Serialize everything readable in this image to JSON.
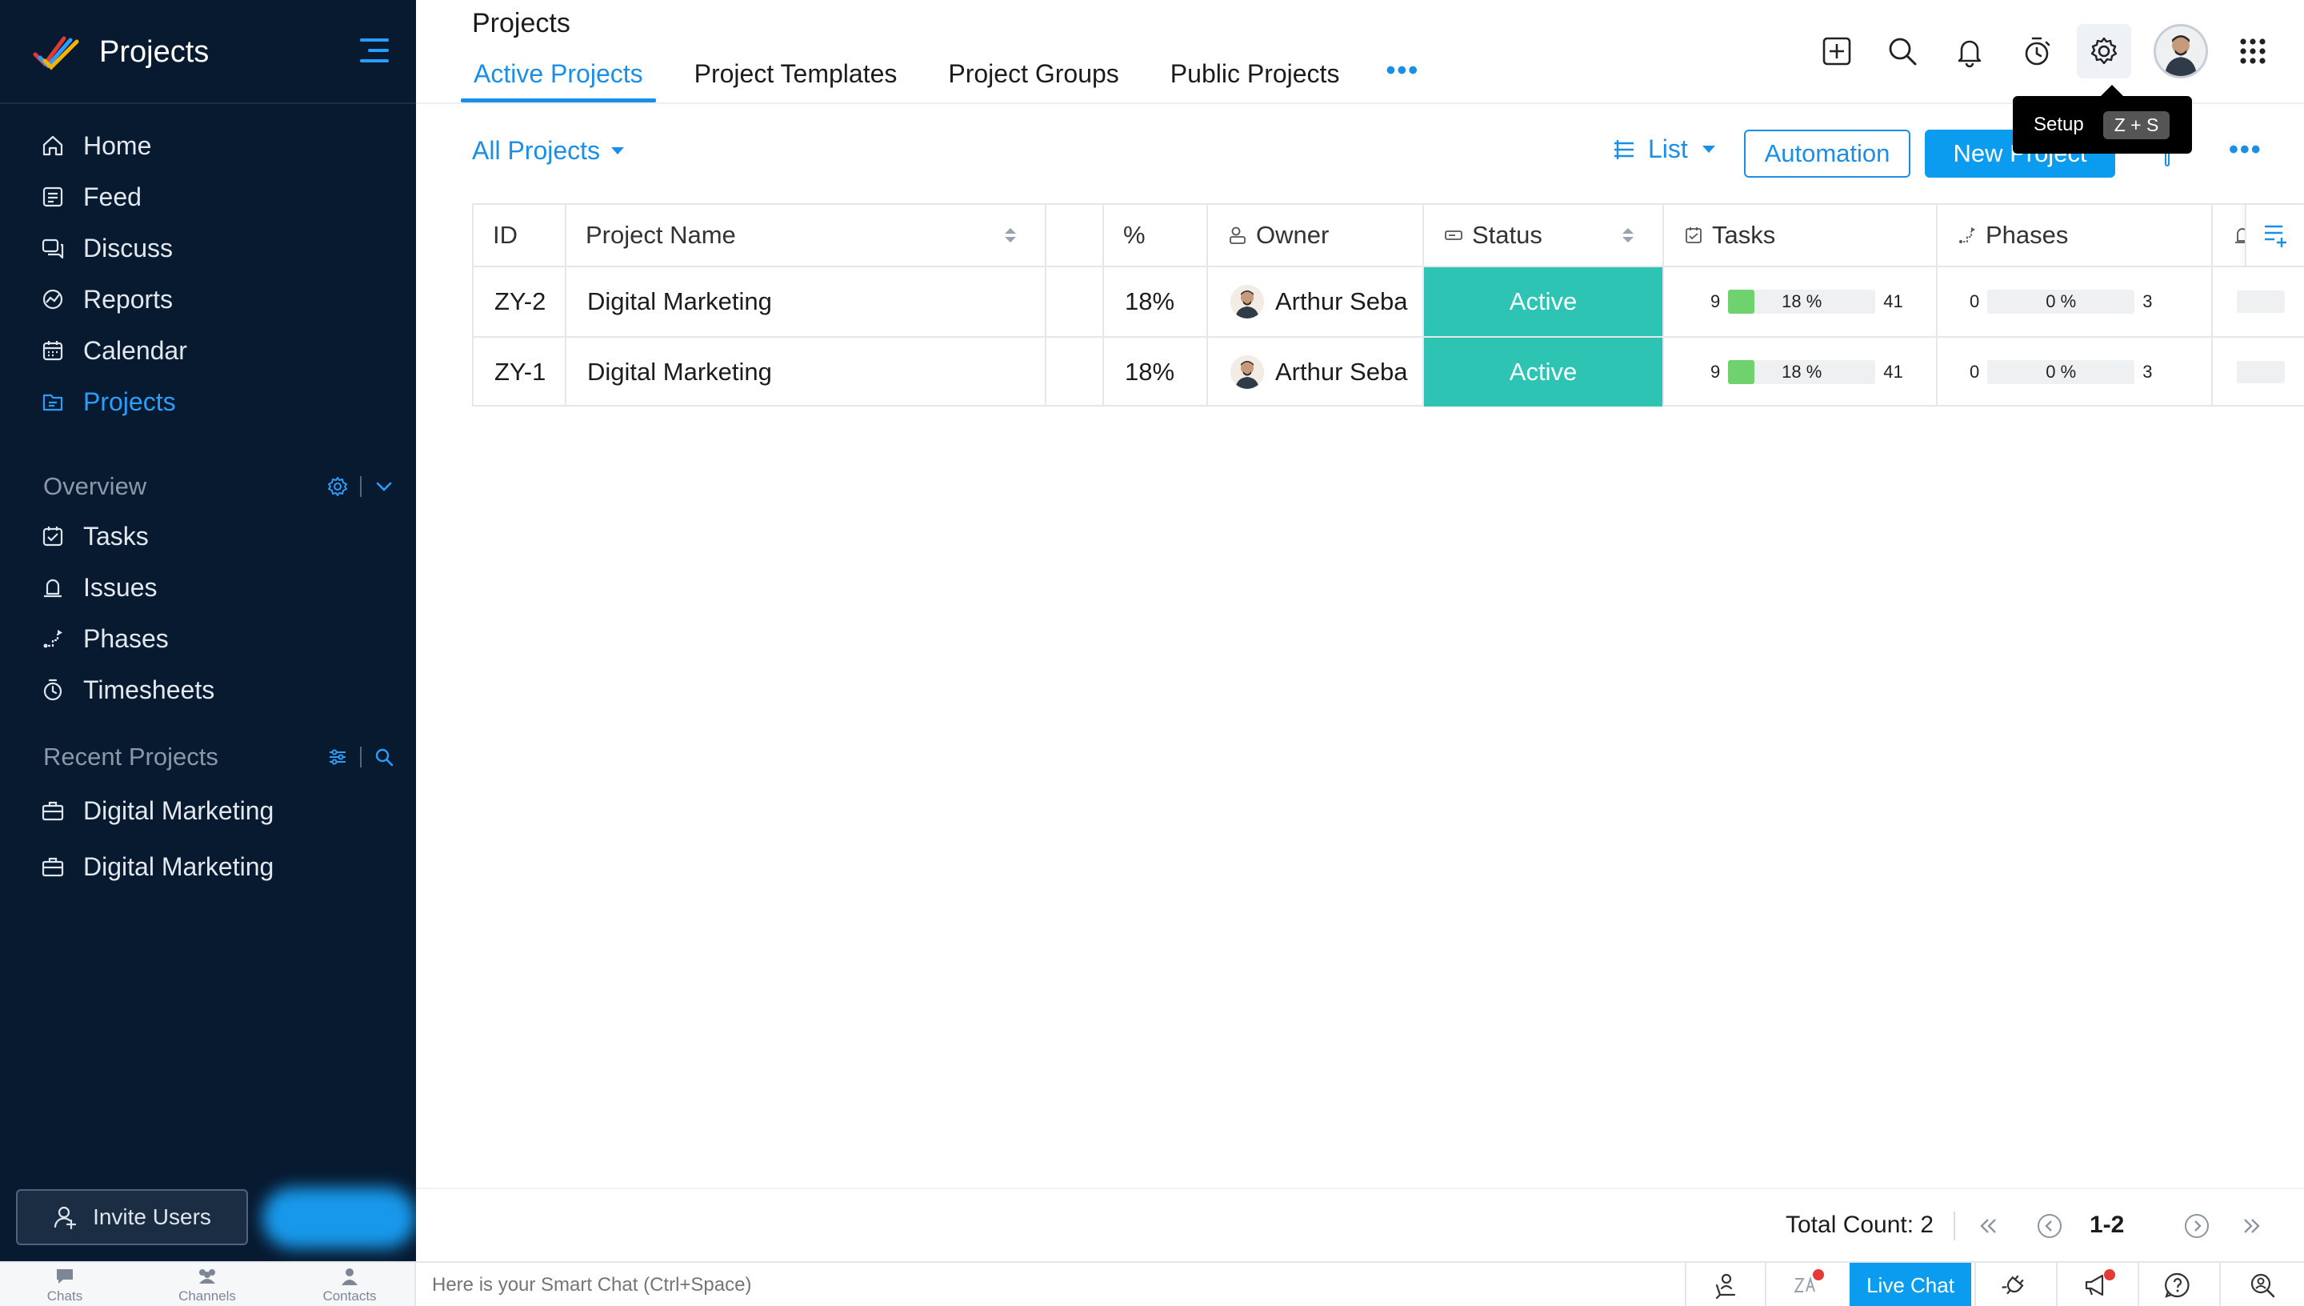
{
  "app": {
    "title": "Projects",
    "colors": {
      "accent": "#1a8fe8",
      "sidebar_bg": "#071a30",
      "status_active": "#2ec4b4",
      "progress_fill": "#6fd26f",
      "live_chat": "#0b9cf0"
    }
  },
  "sidebar": {
    "main_items": [
      {
        "label": "Home",
        "icon": "home-icon"
      },
      {
        "label": "Feed",
        "icon": "feed-icon"
      },
      {
        "label": "Discuss",
        "icon": "discuss-icon"
      },
      {
        "label": "Reports",
        "icon": "reports-icon"
      },
      {
        "label": "Calendar",
        "icon": "calendar-icon"
      },
      {
        "label": "Projects",
        "icon": "projects-icon",
        "active": true
      }
    ],
    "overview": {
      "title": "Overview",
      "items": [
        {
          "label": "Tasks",
          "icon": "tasks-icon"
        },
        {
          "label": "Issues",
          "icon": "issues-icon"
        },
        {
          "label": "Phases",
          "icon": "phases-icon"
        },
        {
          "label": "Timesheets",
          "icon": "timesheets-icon"
        }
      ]
    },
    "recent": {
      "title": "Recent Projects",
      "items": [
        {
          "label": "Digital Marketing",
          "icon": "briefcase-icon"
        },
        {
          "label": "Digital Marketing",
          "icon": "briefcase-icon"
        }
      ]
    },
    "invite_label": "Invite Users"
  },
  "header": {
    "title": "Projects",
    "tabs": [
      {
        "label": "Active Projects",
        "active": true
      },
      {
        "label": "Project Templates"
      },
      {
        "label": "Project Groups"
      },
      {
        "label": "Public Projects"
      }
    ],
    "more": "•••",
    "icons": [
      "add-icon",
      "search-icon",
      "bell-icon",
      "timer-icon",
      "gear-icon",
      "avatar",
      "apps-grid-icon"
    ],
    "tooltip": {
      "label": "Setup",
      "shortcut": "Z + S"
    }
  },
  "toolbar": {
    "filter_label": "All Projects",
    "view_label": "List",
    "automation_label": "Automation",
    "new_project_label": "New Project",
    "more": "•••"
  },
  "table": {
    "columns": [
      {
        "label": "ID"
      },
      {
        "label": "Project Name"
      },
      {
        "label": ""
      },
      {
        "label": "%"
      },
      {
        "label": "Owner",
        "icon": "owner-icon"
      },
      {
        "label": "Status",
        "icon": "status-icon"
      },
      {
        "label": "Tasks",
        "icon": "tasks-icon"
      },
      {
        "label": "Phases",
        "icon": "phases-icon"
      }
    ],
    "rows": [
      {
        "id": "ZY-2",
        "name": "Digital Marketing",
        "percent": "18%",
        "owner": "Arthur Seba",
        "status": "Active",
        "tasks": {
          "open": "9",
          "percent_label": "18 %",
          "fraction": 0.18,
          "closed": "41"
        },
        "phases": {
          "open": "0",
          "percent_label": "0 %",
          "fraction": 0,
          "closed": "3"
        }
      },
      {
        "id": "ZY-1",
        "name": "Digital Marketing",
        "percent": "18%",
        "owner": "Arthur Seba",
        "status": "Active",
        "tasks": {
          "open": "9",
          "percent_label": "18 %",
          "fraction": 0.18,
          "closed": "41"
        },
        "phases": {
          "open": "0",
          "percent_label": "0 %",
          "fraction": 0,
          "closed": "3"
        }
      }
    ]
  },
  "pagination": {
    "total_label": "Total Count: 2",
    "range": "1-2"
  },
  "bottom_bar": {
    "tabs": [
      {
        "label": "Chats",
        "icon": "chat-icon"
      },
      {
        "label": "Channels",
        "icon": "channels-icon"
      },
      {
        "label": "Contacts",
        "icon": "contacts-icon"
      }
    ],
    "smart_chat_placeholder": "Here is your Smart Chat (Ctrl+Space)",
    "live_chat_label": "Live Chat"
  }
}
